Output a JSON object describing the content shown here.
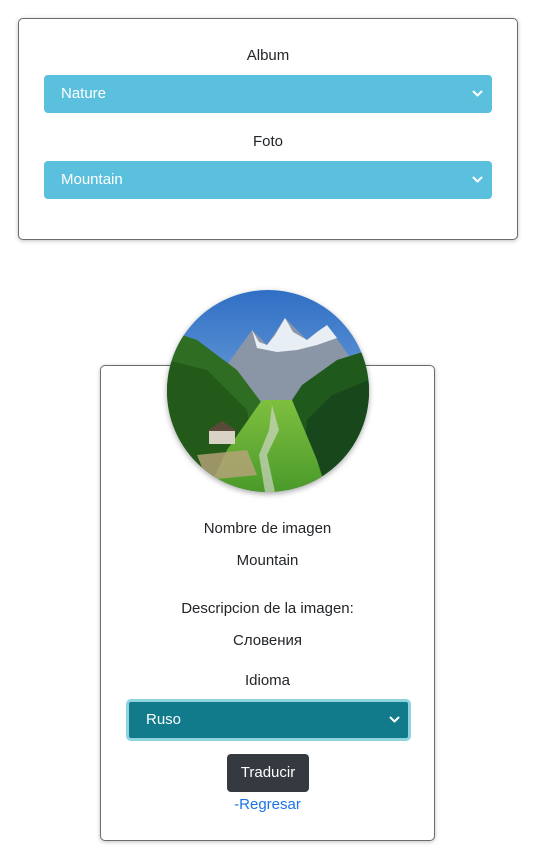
{
  "selector_card": {
    "album_label": "Album",
    "album_value": "Nature",
    "photo_label": "Foto",
    "photo_value": "Mountain"
  },
  "detail_card": {
    "name_label": "Nombre de imagen",
    "name_value": "Mountain",
    "description_label": "Descripcion de la imagen:",
    "description_value": "Словения",
    "language_label": "Idioma",
    "language_value": "Ruso",
    "translate_button": "Traducir",
    "back_link": "-Regresar"
  },
  "icons": {
    "select_chevron": "chevron-down-icon",
    "photo": "mountain-valley-photo"
  },
  "colors": {
    "info_select": "#5bc0de",
    "teal_select": "#117a8b",
    "dark_button": "#343a40",
    "link": "#1a73e8"
  }
}
